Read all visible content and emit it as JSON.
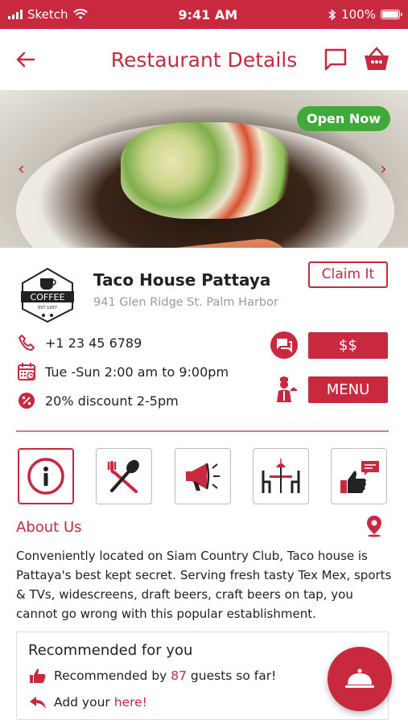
{
  "status_bar": {
    "carrier": "Sketch",
    "time": "9:41 AM",
    "battery": "100%"
  },
  "header": {
    "title": "Restaurant Details"
  },
  "hero": {
    "badge": "Open Now"
  },
  "restaurant": {
    "logo_text": "COFFEE",
    "logo_subtext": "EST 1957",
    "name": "Taco House Pattaya",
    "address": "941 Glen Ridge St. Palm Harbor",
    "claim_label": "Claim It",
    "phone": "+1 23 45 6789",
    "hours": "Tue -Sun 2:00 am to 9:00pm",
    "discount": "20% discount 2-5pm",
    "price_label": "$$",
    "menu_label": "MENU"
  },
  "features": [
    {
      "icon": "info-icon"
    },
    {
      "icon": "fork-spoon-icon"
    },
    {
      "icon": "megaphone-icon"
    },
    {
      "icon": "dining-table-icon"
    },
    {
      "icon": "thumbs-up-chat-icon"
    }
  ],
  "about": {
    "title": "About Us",
    "text": "Conveniently located on Siam Country Club, Taco house is Pattaya's best kept secret.  Serving fresh tasty Tex Mex, sports & TVs, widescreens, draft beers, craft beers on tap, you cannot go wrong with this popular establishment."
  },
  "recommended": {
    "title": "Recommended for you",
    "line1_prefix": "Recommended by ",
    "count": "87",
    "line1_suffix": " guests so far!",
    "line2_prefix": "Add your ",
    "line2_link": "here!"
  },
  "colors": {
    "accent": "#c8293f",
    "open_badge": "#3fa93a"
  }
}
